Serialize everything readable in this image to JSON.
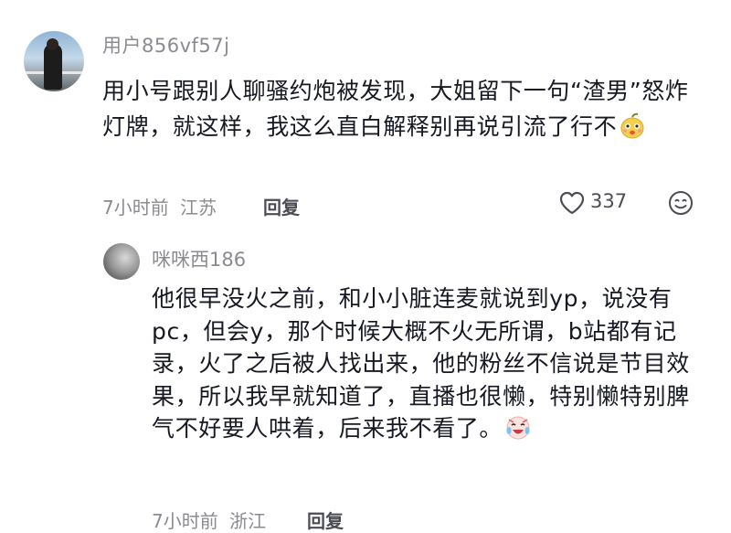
{
  "comment": {
    "username": "用户856vf57j",
    "text": "用小号跟别人聊骚约炮被发现，大姐留下一句“渣男”怒炸灯牌，就这样，我这么直白解释别再说引流了行不",
    "time": "7小时前",
    "location": "江苏",
    "reply_label": "回复",
    "like_count": "337",
    "avatar_icon": "avatar-photo",
    "emoji_icon": "pear-face-emoji",
    "like_icon": "heart-outline-icon",
    "react_icon": "smiley-icon"
  },
  "reply": {
    "username": "咪咪西186",
    "text": "他很早没火之前，和小小脏连麦就说到yp，说没有pc，但会y，那个时候大概不火无所谓，b站都有记录，火了之后被人找出来，他的粉丝不信说是节目效果，所以我早就知道了，直播也很懒，特别懒特别脾气不好要人哄着，后来我不看了。",
    "time": "7小时前",
    "location": "浙江",
    "reply_label": "回复",
    "emoji_icon": "crying-laugh-emoji"
  },
  "colors": {
    "text": "#161823",
    "muted": "#8a8b91",
    "action": "#4b4c55"
  }
}
